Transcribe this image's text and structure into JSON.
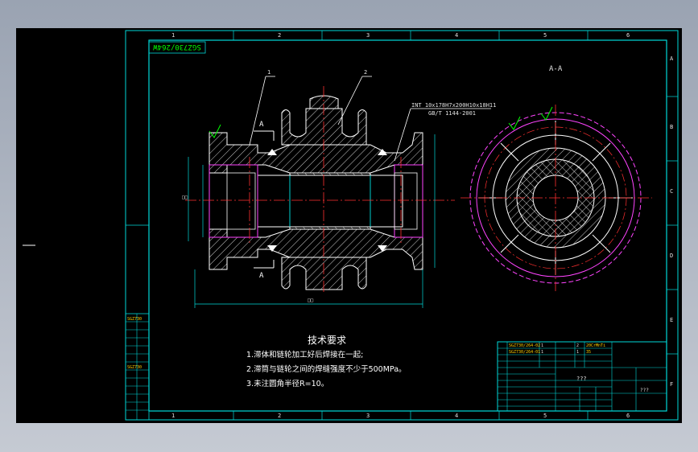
{
  "drawing": {
    "code_box": "SGZ730/264W",
    "section_title": "A-A",
    "section_marker": "A",
    "callouts": [
      "1",
      "2"
    ],
    "spline_spec": "INT 10x178H7x200H10x18H11",
    "spline_standard": "GB/T 1144-2001",
    "length_dim": "□□",
    "side_dim": "□□"
  },
  "requirements": {
    "title": "技术要求",
    "items": [
      "1.滞体和链轮加工好后焊接在一起;",
      "2.滞筒与链轮之间的焊缝强度不少于500MPa。",
      "3.未注圆角半径R=10。"
    ]
  },
  "border": {
    "top_zones": [
      "1",
      "2",
      "3",
      "4",
      "5",
      "6"
    ],
    "bottom_zones": [
      "1",
      "2",
      "3",
      "4",
      "5",
      "6"
    ],
    "right_zones": [
      "A",
      "B",
      "C",
      "D",
      "E",
      "F"
    ]
  },
  "left_strip": {
    "code_1": "SGZ730",
    "code_2": "SGZ730"
  },
  "title_block": {
    "row1": [
      "SGZ730/264-02",
      "1",
      "2",
      "20CrMnTi",
      "—"
    ],
    "row2": [
      "SGZ730/264-01",
      "1",
      "1",
      "35",
      "—"
    ],
    "name": "???",
    "drawing_no": "???"
  }
}
